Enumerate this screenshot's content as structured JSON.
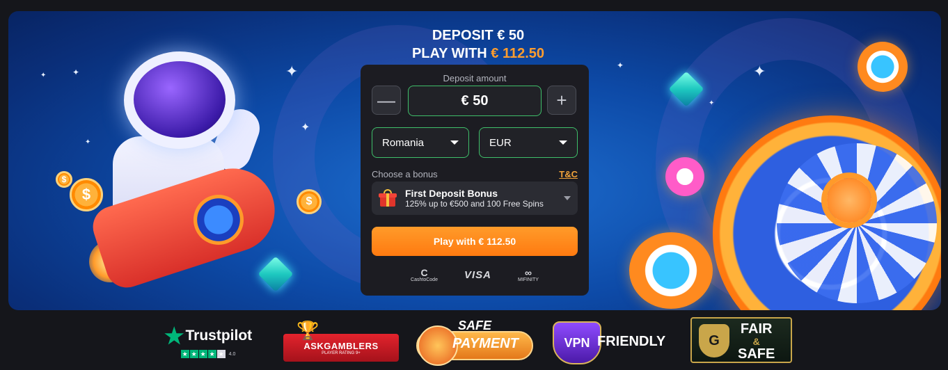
{
  "promo": {
    "deposit_line": "DEPOSIT € 50",
    "play_prefix": "PLAY WITH ",
    "play_amount": "€ 112.50"
  },
  "widget": {
    "deposit_label": "Deposit amount",
    "amount_value": "€ 50",
    "decrement_glyph": "—",
    "increment_glyph": "+",
    "country": "Romania",
    "currency": "EUR",
    "bonus_label": "Choose a bonus",
    "tnc_link": "T&C",
    "bonus_title": "First Deposit Bonus",
    "bonus_description": "125% up to €500 and 100 Free Spins",
    "play_button": "Play with € 112.50"
  },
  "payments": [
    {
      "icon": "cashtocode-icon",
      "glyph": "C",
      "label": "CashtoCode"
    },
    {
      "icon": "visa-icon",
      "label": "VISA"
    },
    {
      "icon": "mifinity-icon",
      "glyph": "∞",
      "label": "MIFINITY"
    }
  ],
  "badges": {
    "trustpilot": {
      "name": "Trustpilot",
      "rating": "4.0",
      "stars_filled": 4,
      "stars_total": 5
    },
    "askgamblers": {
      "name": "ASKGAMBLERS",
      "subtitle": "PLAYER RATING 9+"
    },
    "safe_payment": {
      "line1": "SAFE",
      "line2": "PAYMENT"
    },
    "vpn": {
      "badge": "VPN",
      "label": "FRIENDLY"
    },
    "fair_safe": {
      "line1": "FAIR",
      "amp": "&",
      "line2": "SAFE",
      "crest": "G"
    }
  },
  "colors": {
    "accent_orange": "#ff8a1f",
    "field_green": "#3fbf6a",
    "trustpilot_green": "#00b67a",
    "panel": "#1c1c22"
  }
}
